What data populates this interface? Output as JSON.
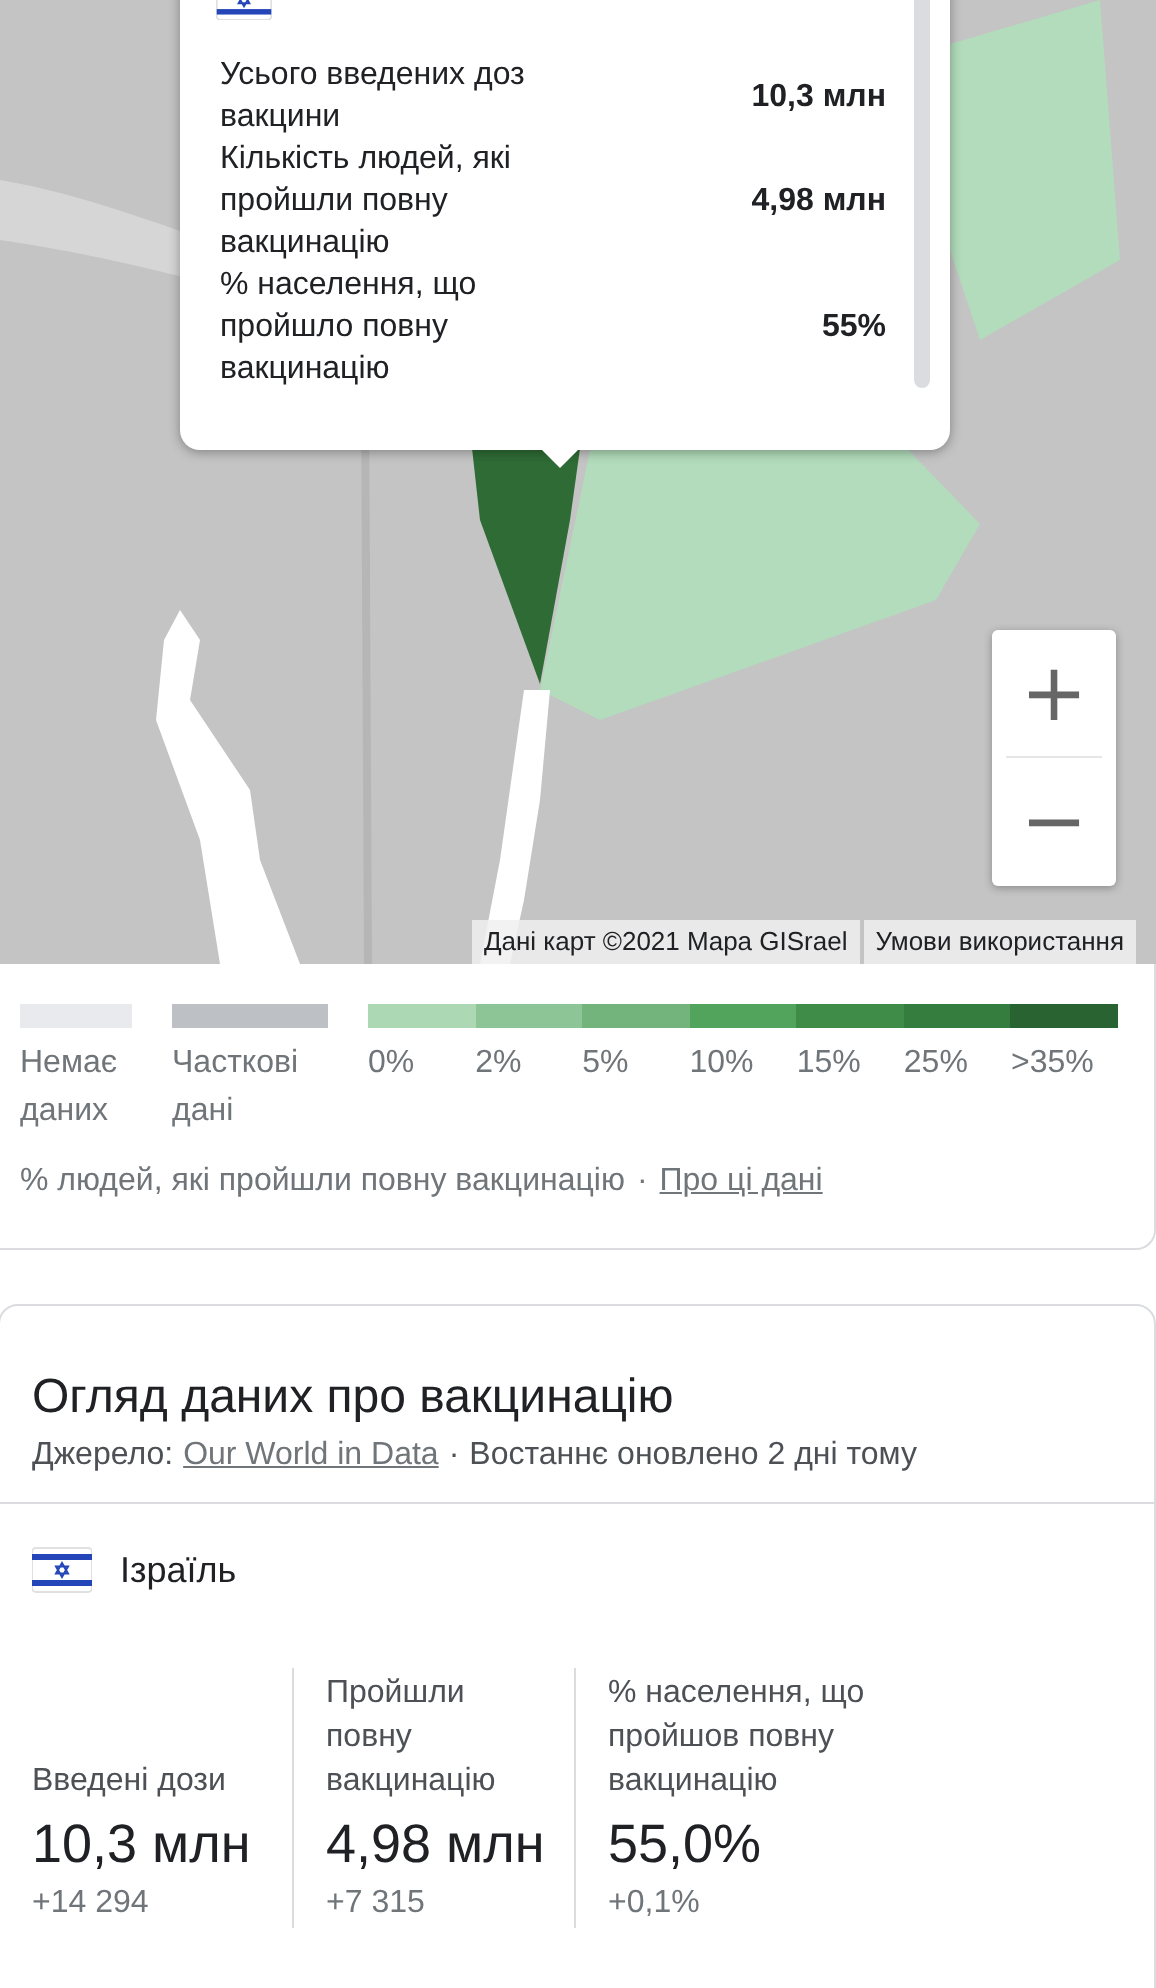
{
  "map": {
    "popup": {
      "rows": [
        {
          "label": "Усього введених доз вакцини",
          "value": "10,3 млн"
        },
        {
          "label": "Кількість людей, які пройшли повну вакцинацію",
          "value": "4,98 млн"
        },
        {
          "label": "% населення, що пройшло повну вакцинацію",
          "value": "55%"
        }
      ]
    },
    "zoom": {
      "in": "+",
      "out": "−"
    },
    "attribution": {
      "data": "Дані карт ©2021 Mapa GISrael",
      "terms": "Умови використання"
    }
  },
  "legend": {
    "items": [
      {
        "label": "Немає даних",
        "color": "#e8eaed"
      },
      {
        "label": "Часткові дані",
        "color": "#bdc1c6"
      }
    ],
    "scale": [
      {
        "label": "0%",
        "color": "#acd9b4"
      },
      {
        "label": "2%",
        "color": "#8ec597"
      },
      {
        "label": "5%",
        "color": "#72b47b"
      },
      {
        "label": "10%",
        "color": "#52a35c"
      },
      {
        "label": "15%",
        "color": "#3e8c48"
      },
      {
        "label": "25%",
        "color": "#357d3f"
      },
      {
        "label": ">35%",
        "color": "#2a6332"
      }
    ],
    "caption": "% людей, які пройшли повну вакцинацію",
    "separator": "·",
    "link": "Про ці дані"
  },
  "overview": {
    "title": "Огляд даних про вакцинацію",
    "source_label": "Джерело:",
    "source_link": "Our World in Data",
    "separator": "·",
    "updated": "Востаннє оновлено 2 дні тому",
    "country": "Ізраїль",
    "stats": [
      {
        "label": "Введені дози",
        "value": "10,3 млн",
        "change": "+14 294"
      },
      {
        "label": "Пройшли повну вакцинацію",
        "value": "4,98 млн",
        "change": "+7 315"
      },
      {
        "label": "% населення, що пройшов повну вакцинацію",
        "value": "55,0%",
        "change": "+0,1%"
      }
    ]
  }
}
